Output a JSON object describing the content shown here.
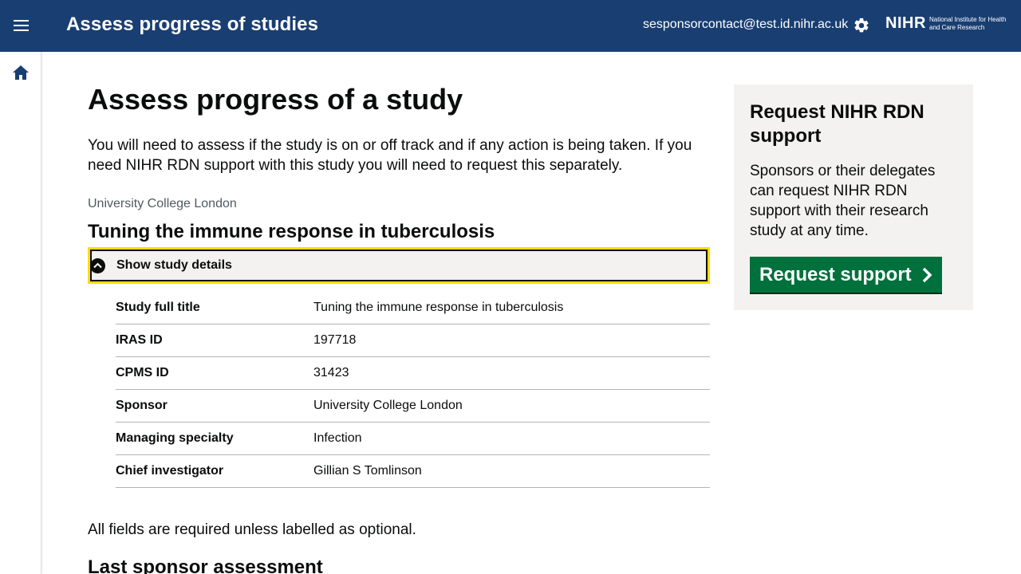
{
  "header": {
    "app_title": "Assess progress of studies",
    "user_email": "sesponsorcontact@test.id.nihr.ac.uk",
    "logo_mark": "NIHR",
    "logo_text": "National Institute for Health and Care Research",
    "menu_icon": "hamburger-menu-icon",
    "settings_icon": "gear-icon"
  },
  "sidenav": {
    "home_icon": "home-icon"
  },
  "main": {
    "page_title": "Assess progress of a study",
    "intro": "You will need to assess if the study is on or off track and if any action is being taken. If you need NIHR RDN support with this study you will need to request this separately.",
    "org_caption": "University College London",
    "study_title": "Tuning the immune response in tuberculosis",
    "details_toggle_label": "Show study details",
    "summary": [
      {
        "key": "Study full title",
        "value": "Tuning the immune response in tuberculosis"
      },
      {
        "key": "IRAS ID",
        "value": "197718"
      },
      {
        "key": "CPMS ID",
        "value": "31423"
      },
      {
        "key": "Sponsor",
        "value": "University College London"
      },
      {
        "key": "Managing specialty",
        "value": "Infection"
      },
      {
        "key": "Chief investigator",
        "value": "Gillian S Tomlinson"
      }
    ],
    "required_note": "All fields are required unless labelled as optional.",
    "section_heading": "Last sponsor assessment"
  },
  "aside": {
    "title": "Request NIHR RDN support",
    "body": "Sponsors or their delegates can request NIHR RDN support with their research study at any time.",
    "button_label": "Request support"
  },
  "colors": {
    "header_bg": "#193e72",
    "focus_yellow": "#ffdd00",
    "button_green": "#00703c",
    "panel_grey": "#f3f2f1"
  }
}
